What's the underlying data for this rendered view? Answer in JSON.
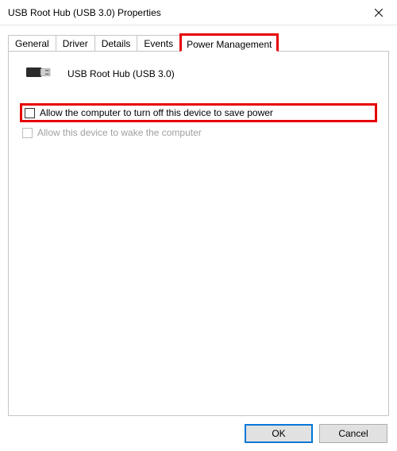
{
  "window": {
    "title": "USB Root Hub (USB 3.0) Properties"
  },
  "tabs": {
    "general": "General",
    "driver": "Driver",
    "details": "Details",
    "events": "Events",
    "power": "Power Management"
  },
  "device": {
    "name": "USB Root Hub (USB 3.0)"
  },
  "options": {
    "allow_off": "Allow the computer to turn off this device to save power",
    "allow_wake": "Allow this device to wake the computer"
  },
  "buttons": {
    "ok": "OK",
    "cancel": "Cancel"
  }
}
